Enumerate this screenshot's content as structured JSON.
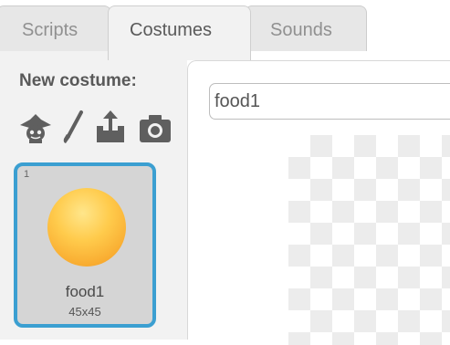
{
  "tabs": {
    "scripts": "Scripts",
    "costumes": "Costumes",
    "sounds": "Sounds"
  },
  "sidebar": {
    "new_costume_label": "New costume:",
    "icons": [
      "paint-new-costume-icon",
      "brush-icon",
      "upload-icon",
      "camera-icon"
    ],
    "costumes": [
      {
        "number": "1",
        "name": "food1",
        "size": "45x45"
      }
    ]
  },
  "editor": {
    "costume_name_value": "food1"
  },
  "colors": {
    "selected_border": "#3b9fd1",
    "icon_gray": "#5f5f5f",
    "ball_orange": "#f8aa2f"
  }
}
